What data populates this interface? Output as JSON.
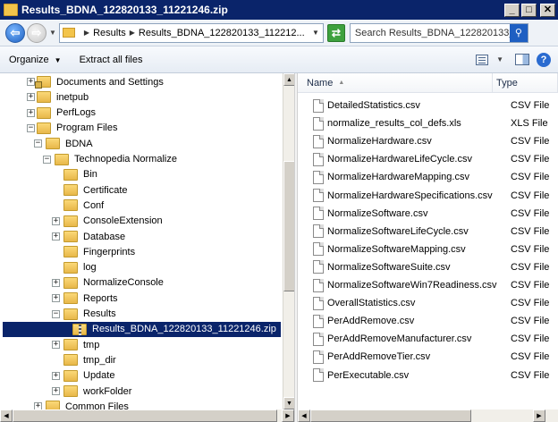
{
  "window": {
    "title": "Results_BDNA_122820133_11221246.zip"
  },
  "addressbar": {
    "crumbs": [
      "Results",
      "Results_BDNA_122820133_112212..."
    ],
    "search_placeholder": "Search Results_BDNA_122820133_11..."
  },
  "toolbar": {
    "organize_label": "Organize",
    "extract_label": "Extract all files"
  },
  "tree": {
    "items": [
      {
        "label": "Documents and Settings",
        "expander": "+",
        "icon": "folder-locked-icon"
      },
      {
        "label": "inetpub",
        "expander": "+",
        "icon": "folder-icon"
      },
      {
        "label": "PerfLogs",
        "expander": "+",
        "icon": "folder-icon"
      },
      {
        "label": "Program Files",
        "expander": "-",
        "icon": "folder-icon"
      },
      {
        "label": "BDNA",
        "expander": "-",
        "icon": "folder-icon"
      },
      {
        "label": "Technopedia Normalize",
        "expander": "-",
        "icon": "folder-icon"
      },
      {
        "label": "Bin",
        "expander": "",
        "icon": "folder-icon"
      },
      {
        "label": "Certificate",
        "expander": "",
        "icon": "folder-icon"
      },
      {
        "label": "Conf",
        "expander": "",
        "icon": "folder-icon"
      },
      {
        "label": "ConsoleExtension",
        "expander": "+",
        "icon": "folder-icon"
      },
      {
        "label": "Database",
        "expander": "+",
        "icon": "folder-icon"
      },
      {
        "label": "Fingerprints",
        "expander": "",
        "icon": "folder-icon"
      },
      {
        "label": "log",
        "expander": "",
        "icon": "folder-icon"
      },
      {
        "label": "NormalizeConsole",
        "expander": "+",
        "icon": "folder-icon"
      },
      {
        "label": "Reports",
        "expander": "+",
        "icon": "folder-icon"
      },
      {
        "label": "Results",
        "expander": "-",
        "icon": "folder-icon"
      },
      {
        "label": "Results_BDNA_122820133_11221246.zip",
        "expander": "",
        "icon": "zip-folder-icon",
        "selected": true
      },
      {
        "label": "tmp",
        "expander": "+",
        "icon": "folder-icon"
      },
      {
        "label": "tmp_dir",
        "expander": "",
        "icon": "folder-icon"
      },
      {
        "label": "Update",
        "expander": "+",
        "icon": "folder-icon"
      },
      {
        "label": "workFolder",
        "expander": "+",
        "icon": "folder-icon"
      },
      {
        "label": "Common Files",
        "expander": "+",
        "icon": "folder-icon"
      }
    ]
  },
  "filelist": {
    "columns": {
      "name": "Name",
      "type": "Type"
    },
    "files": [
      {
        "name": "DetailedStatistics.csv",
        "type": "CSV File"
      },
      {
        "name": "normalize_results_col_defs.xls",
        "type": "XLS File"
      },
      {
        "name": "NormalizeHardware.csv",
        "type": "CSV File"
      },
      {
        "name": "NormalizeHardwareLifeCycle.csv",
        "type": "CSV File"
      },
      {
        "name": "NormalizeHardwareMapping.csv",
        "type": "CSV File"
      },
      {
        "name": "NormalizeHardwareSpecifications.csv",
        "type": "CSV File"
      },
      {
        "name": "NormalizeSoftware.csv",
        "type": "CSV File"
      },
      {
        "name": "NormalizeSoftwareLifeCycle.csv",
        "type": "CSV File"
      },
      {
        "name": "NormalizeSoftwareMapping.csv",
        "type": "CSV File"
      },
      {
        "name": "NormalizeSoftwareSuite.csv",
        "type": "CSV File"
      },
      {
        "name": "NormalizeSoftwareWin7Readiness.csv",
        "type": "CSV File"
      },
      {
        "name": "OverallStatistics.csv",
        "type": "CSV File"
      },
      {
        "name": "PerAddRemove.csv",
        "type": "CSV File"
      },
      {
        "name": "PerAddRemoveManufacturer.csv",
        "type": "CSV File"
      },
      {
        "name": "PerAddRemoveTier.csv",
        "type": "CSV File"
      },
      {
        "name": "PerExecutable.csv",
        "type": "CSV File"
      }
    ]
  }
}
